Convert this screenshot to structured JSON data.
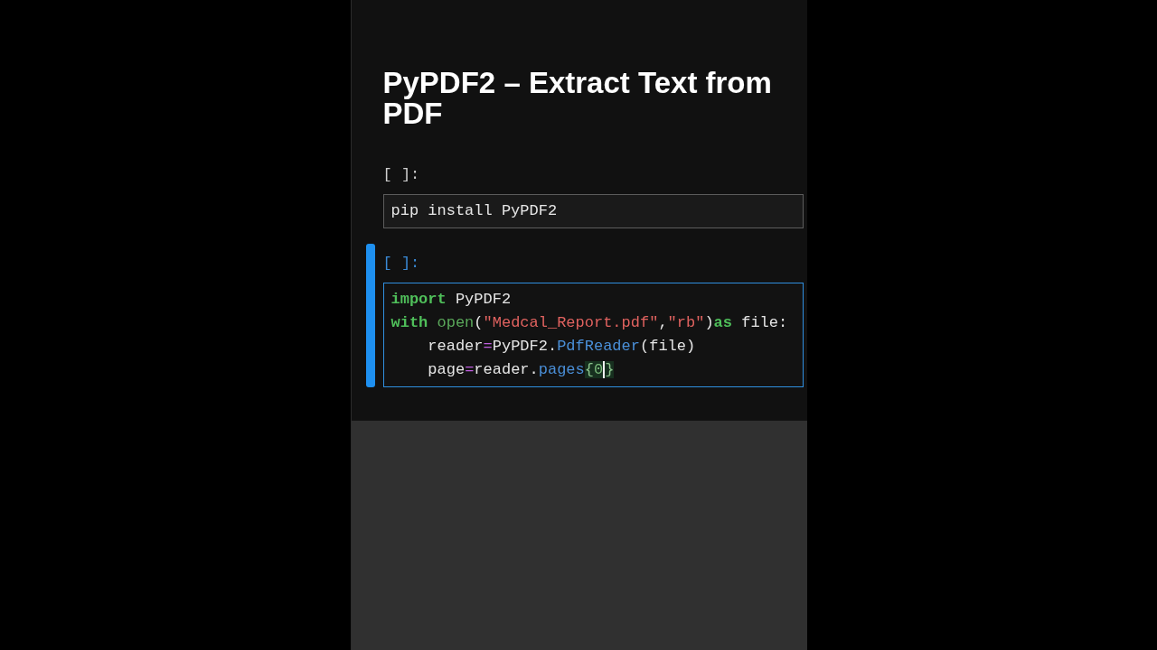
{
  "title": "PyPDF2 – Extract Text from PDF",
  "cells": [
    {
      "prompt": "[ ]:",
      "active": false,
      "lines": [
        {
          "tokens": [
            {
              "kind": "plain",
              "text": "pip install PyPDF2"
            }
          ]
        }
      ]
    },
    {
      "prompt": "[ ]:",
      "active": true,
      "lines": [
        {
          "tokens": [
            {
              "kind": "keyword",
              "text": "import"
            },
            {
              "kind": "plain",
              "text": " PyPDF2"
            }
          ]
        },
        {
          "tokens": [
            {
              "kind": "keyword",
              "text": "with"
            },
            {
              "kind": "builtin",
              "text": " open"
            },
            {
              "kind": "plain",
              "text": "("
            },
            {
              "kind": "string",
              "text": "\"Medcal_Report.pdf\""
            },
            {
              "kind": "plain",
              "text": ","
            },
            {
              "kind": "string",
              "text": "\"rb\""
            },
            {
              "kind": "plain",
              "text": ")"
            },
            {
              "kind": "keyword",
              "text": "as"
            },
            {
              "kind": "plain",
              "text": " file:"
            }
          ]
        },
        {
          "tokens": [
            {
              "kind": "plain",
              "text": "    reader"
            },
            {
              "kind": "operator",
              "text": "="
            },
            {
              "kind": "plain",
              "text": "PyPDF2."
            },
            {
              "kind": "function",
              "text": "PdfReader"
            },
            {
              "kind": "plain",
              "text": "(file)"
            }
          ]
        },
        {
          "tokens": [
            {
              "kind": "plain",
              "text": "    page",
              "cursor": false
            },
            {
              "kind": "operator",
              "text": "=",
              "cursor": false
            },
            {
              "kind": "plain",
              "text": "reader.",
              "cursor": false
            },
            {
              "kind": "function",
              "text": "pages",
              "cursor": false
            },
            {
              "kind": "matched-bracket",
              "text": "{",
              "cursor": false
            },
            {
              "kind": "number",
              "text": "0",
              "cursor": true
            },
            {
              "kind": "matched-bracket",
              "text": "}",
              "cursor": false
            }
          ]
        }
      ]
    }
  ]
}
